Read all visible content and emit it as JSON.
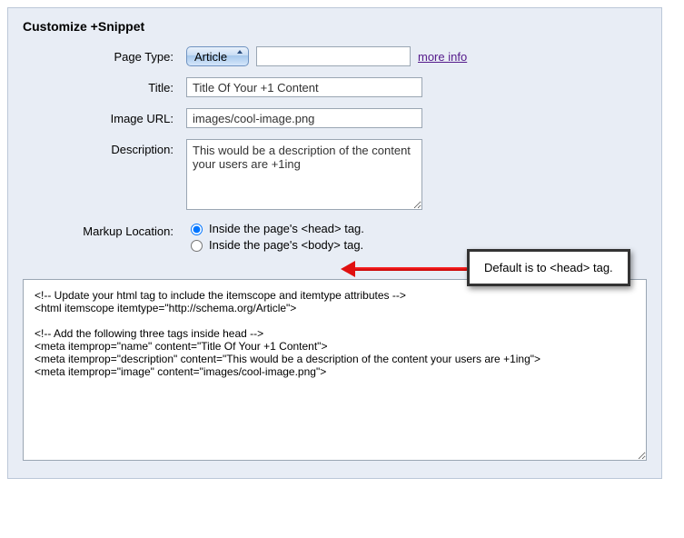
{
  "heading": "Customize +Snippet",
  "labels": {
    "page_type": "Page Type:",
    "title": "Title:",
    "image_url": "Image URL:",
    "description": "Description:",
    "markup_location": "Markup Location:"
  },
  "page_type": {
    "selected": "Article",
    "options": [
      "Article"
    ],
    "extra_value": "",
    "more_info": "more info"
  },
  "title_value": "Title Of Your +1 Content",
  "image_url_value": "images/cool-image.png",
  "description_value": "This would be a description of the content your users are +1ing",
  "markup_location": {
    "option_head": "Inside the page's <head> tag.",
    "option_body": "Inside the page's <body> tag.",
    "selected": "head"
  },
  "callout_text": "Default is to <head> tag.",
  "output_code": "<!-- Update your html tag to include the itemscope and itemtype attributes -->\n<html itemscope itemtype=\"http://schema.org/Article\">\n\n<!-- Add the following three tags inside head -->\n<meta itemprop=\"name\" content=\"Title Of Your +1 Content\">\n<meta itemprop=\"description\" content=\"This would be a description of the content your users are +1ing\">\n<meta itemprop=\"image\" content=\"images/cool-image.png\">"
}
